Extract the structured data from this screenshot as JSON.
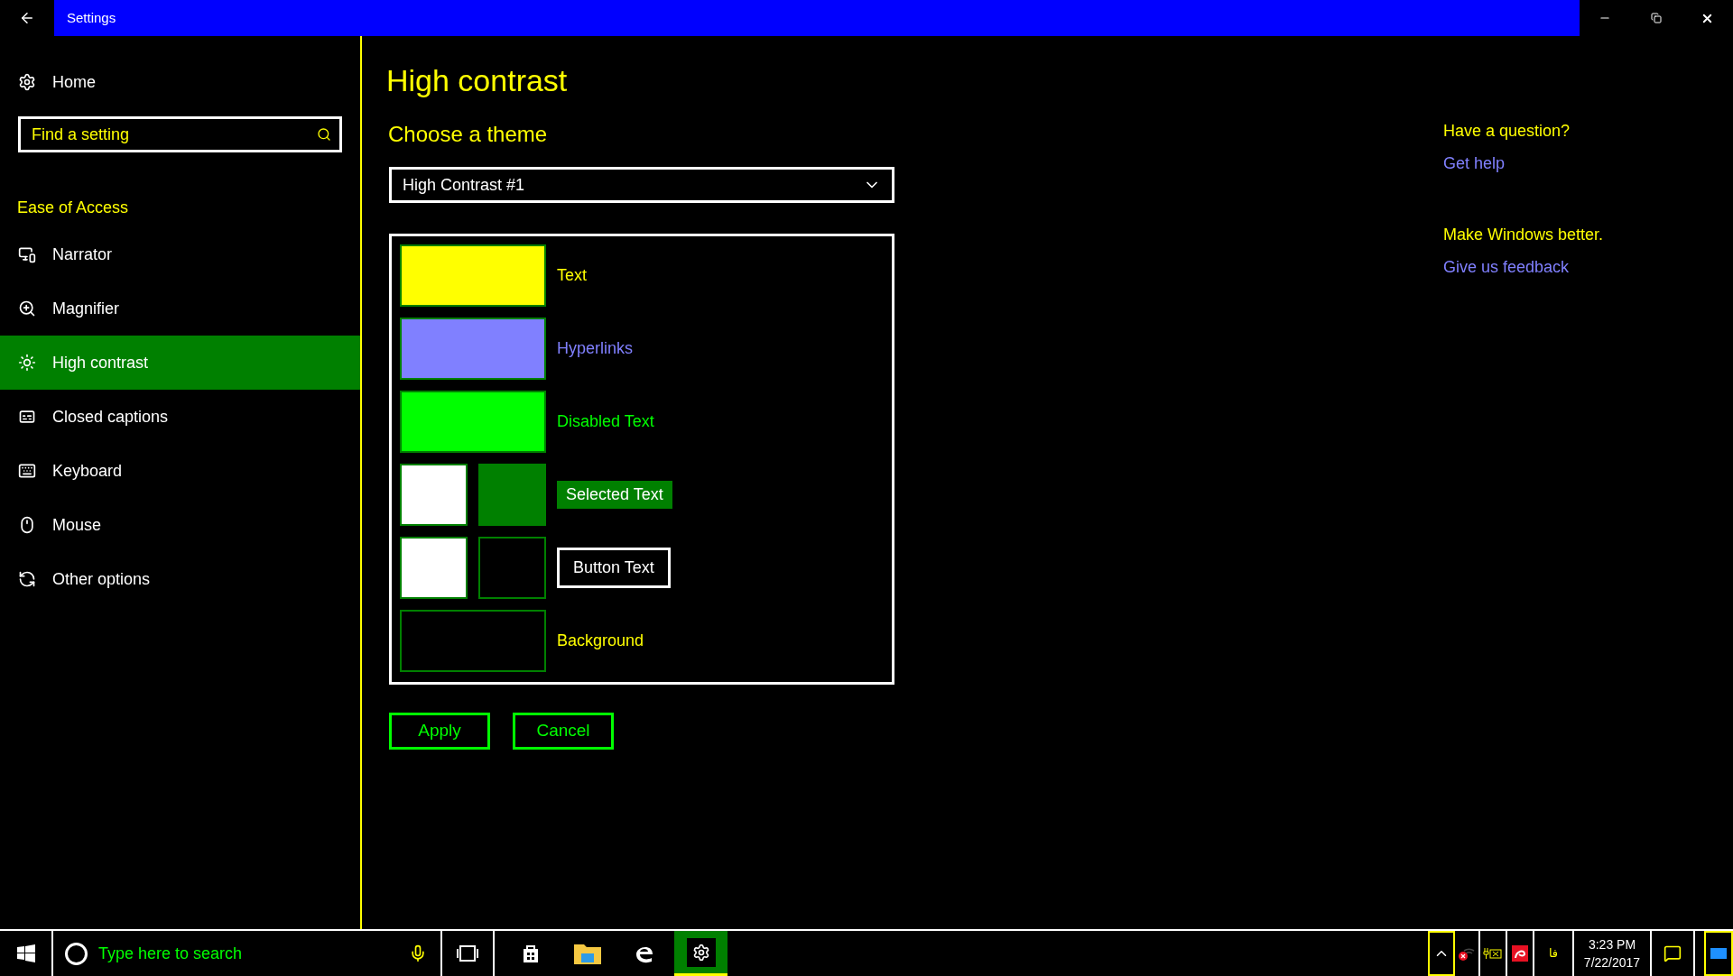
{
  "window": {
    "title": "Settings"
  },
  "sidebar": {
    "home": "Home",
    "search": {
      "placeholder": "Find a setting"
    },
    "section": "Ease of Access",
    "items": [
      {
        "label": "Narrator",
        "selected": false
      },
      {
        "label": "Magnifier",
        "selected": false
      },
      {
        "label": "High contrast",
        "selected": true
      },
      {
        "label": "Closed captions",
        "selected": false
      },
      {
        "label": "Keyboard",
        "selected": false
      },
      {
        "label": "Mouse",
        "selected": false
      },
      {
        "label": "Other options",
        "selected": false
      }
    ]
  },
  "main": {
    "title": "High contrast",
    "subtitle": "Choose a theme",
    "theme_dropdown": {
      "value": "High Contrast #1"
    },
    "preview": [
      {
        "label": "Text",
        "kind": "text",
        "swatches": [
          {
            "color": "#ffff00"
          }
        ]
      },
      {
        "label": "Hyperlinks",
        "kind": "link",
        "swatches": [
          {
            "color": "#8080ff"
          }
        ]
      },
      {
        "label": "Disabled Text",
        "kind": "disabled",
        "swatches": [
          {
            "color": "#00ff00"
          }
        ]
      },
      {
        "label": "Selected Text",
        "kind": "highlight",
        "swatches": [
          {
            "color": "#ffffff"
          },
          {
            "color": "#008000"
          }
        ]
      },
      {
        "label": "Button Text",
        "kind": "button",
        "swatches": [
          {
            "color": "#ffffff"
          },
          {
            "color": "#000000"
          }
        ]
      },
      {
        "label": "Background",
        "kind": "background",
        "swatches": [
          {
            "color": "#000000"
          }
        ]
      }
    ],
    "buttons": [
      "Apply",
      "Cancel"
    ]
  },
  "help": [
    {
      "heading": "Have a question?",
      "link": "Get help"
    },
    {
      "heading": "Make Windows better.",
      "link": "Give us feedback"
    }
  ],
  "taskbar": {
    "search": {
      "placeholder": "Type here to search"
    },
    "apps": [
      {
        "selected": false
      },
      {
        "selected": false
      },
      {
        "selected": false
      },
      {
        "selected": true
      }
    ],
    "language": "فا",
    "time": "3:23 PM",
    "date": "7/22/2017"
  }
}
